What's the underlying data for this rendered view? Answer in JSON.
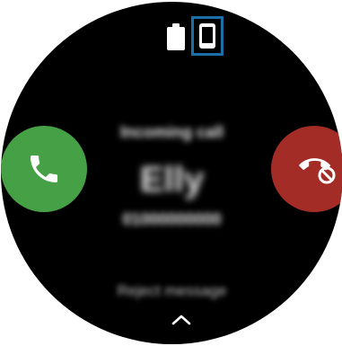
{
  "screen": {
    "caller_status": "Incoming call",
    "caller_name": "Elly",
    "caller_number": "01000000000",
    "reject_message_label": "Reject message"
  },
  "icons": {
    "battery": "battery-icon",
    "phone": "phone-icon",
    "accept": "phone-call-icon",
    "reject": "phone-reject-icon",
    "swipe": "chevron-up-icon"
  },
  "colors": {
    "background": "#000000",
    "accept_green": "#45a046",
    "reject_red": "#a32c27",
    "highlight_blue": "#1a6fa8"
  }
}
